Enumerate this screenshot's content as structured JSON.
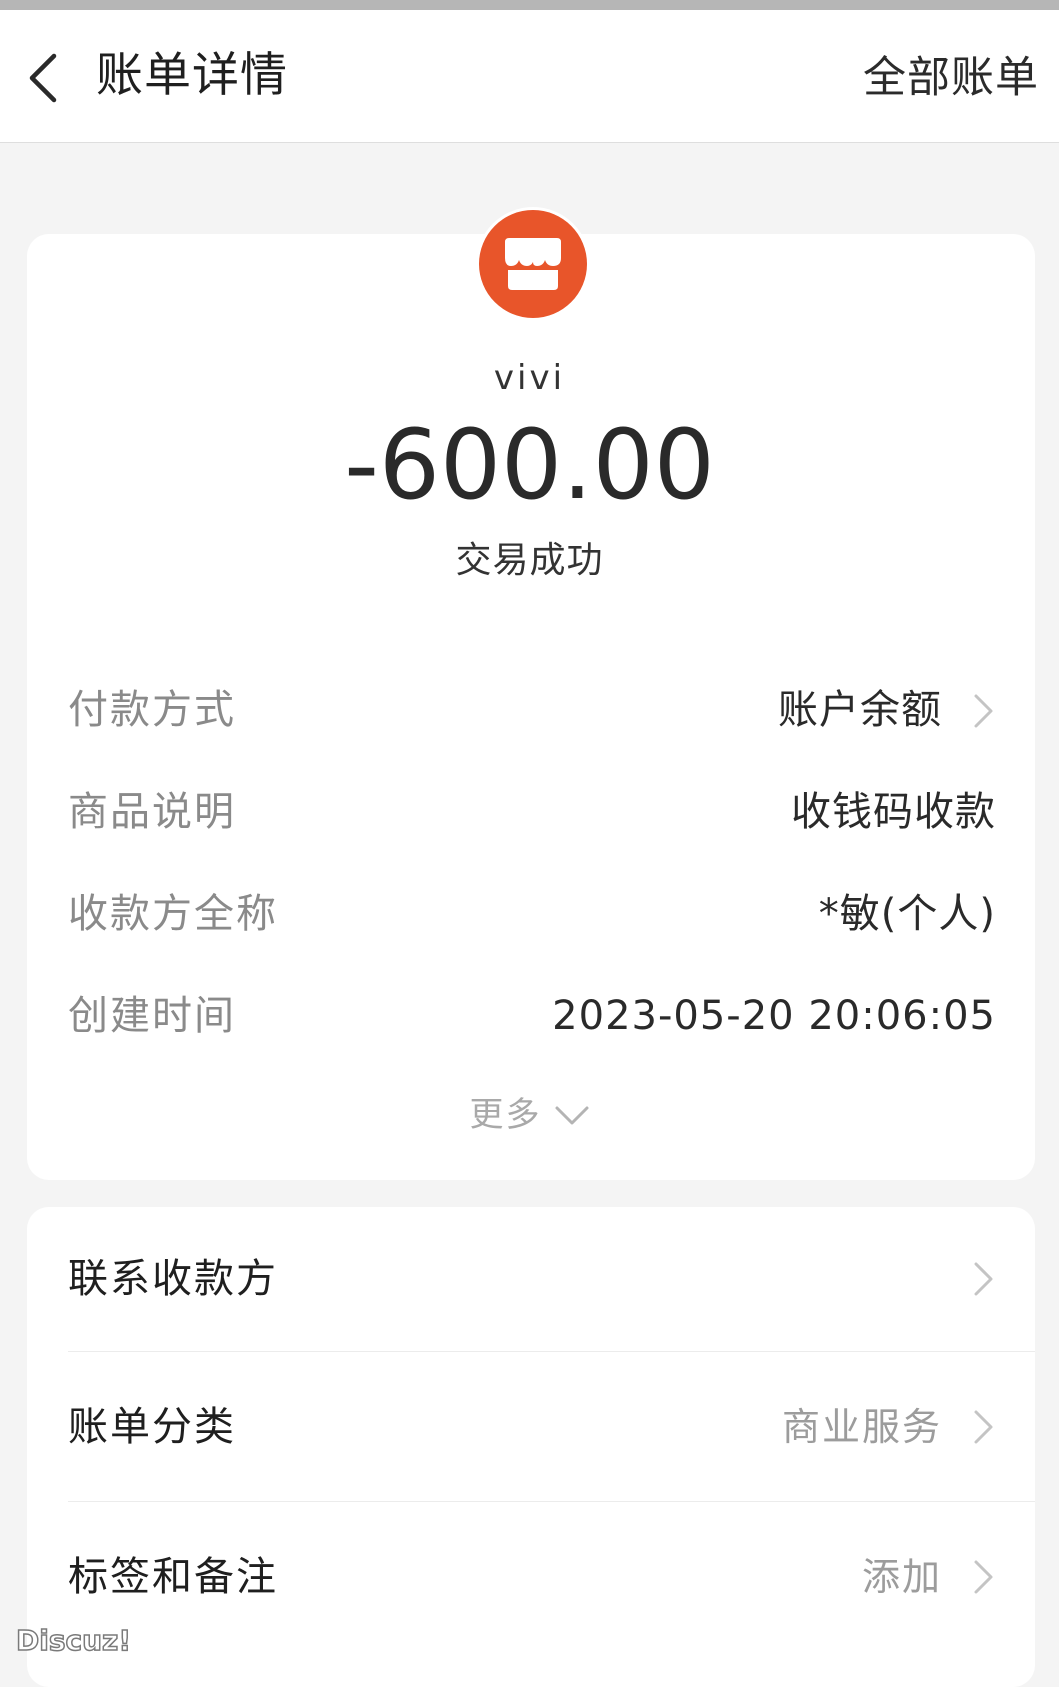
{
  "header": {
    "title": "账单详情",
    "right_action": "全部账单"
  },
  "transaction": {
    "merchant_name": "vivi",
    "amount": "-600.00",
    "status": "交易成功"
  },
  "details": {
    "payment_method": {
      "label": "付款方式",
      "value": "账户余额"
    },
    "product_description": {
      "label": "商品说明",
      "value": "收钱码收款"
    },
    "payee_full_name": {
      "label": "收款方全称",
      "value": "*敏(个人)"
    },
    "created_time": {
      "label": "创建时间",
      "value": "2023-05-20 20:06:05"
    },
    "more_label": "更多"
  },
  "actions": {
    "contact_payee": {
      "label": "联系收款方"
    },
    "bill_category": {
      "label": "账单分类",
      "value": "商业服务"
    },
    "tags_notes": {
      "label": "标签和备注",
      "value": "添加"
    }
  },
  "watermark": "Discuz!",
  "colors": {
    "accent": "#e8552a",
    "background": "#f4f4f4",
    "card": "#ffffff",
    "muted_text": "#8a8a8a"
  },
  "icons": {
    "back": "chevron-left-icon",
    "merchant": "shop-icon",
    "row_arrow": "chevron-right-icon",
    "expand": "chevron-down-icon"
  }
}
